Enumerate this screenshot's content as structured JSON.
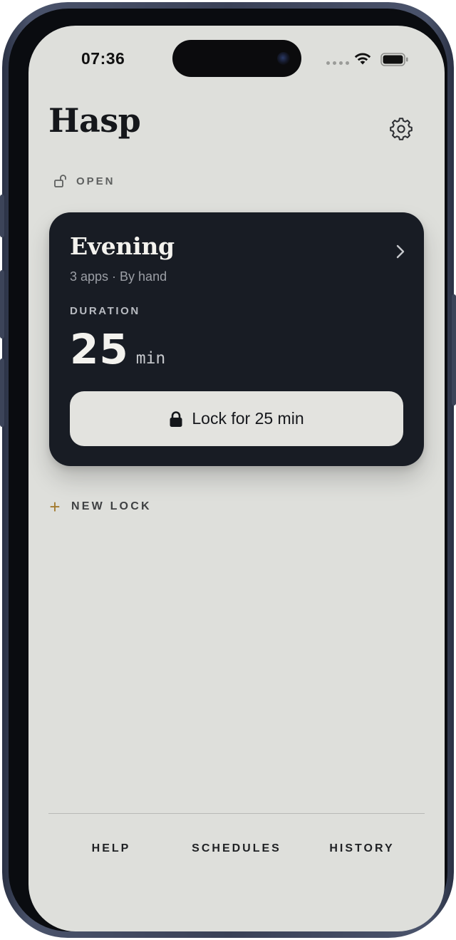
{
  "status_bar": {
    "time": "07:36"
  },
  "header": {
    "title": "Hasp",
    "settings_icon": "gear-icon"
  },
  "lock_state": {
    "icon": "unlocked-padlock-icon",
    "label": "OPEN"
  },
  "card": {
    "title": "Evening",
    "meta": "3 apps · By hand",
    "duration_label": "DURATION",
    "duration_value": "25",
    "duration_unit": "min",
    "action_label": "Lock for 25 min",
    "action_icon": "padlock-icon",
    "open_icon": "chevron-right-icon"
  },
  "new_lock": {
    "label": "NEW LOCK",
    "icon": "plus-icon"
  },
  "bottom_nav": {
    "items": [
      {
        "label": "HELP"
      },
      {
        "label": "SCHEDULES"
      },
      {
        "label": "HISTORY"
      }
    ]
  },
  "colors": {
    "screen_background": "#dedfdb",
    "card_background": "#181c24",
    "accent_plus": "#a27a2e",
    "phone_frame": "#3a4157"
  }
}
